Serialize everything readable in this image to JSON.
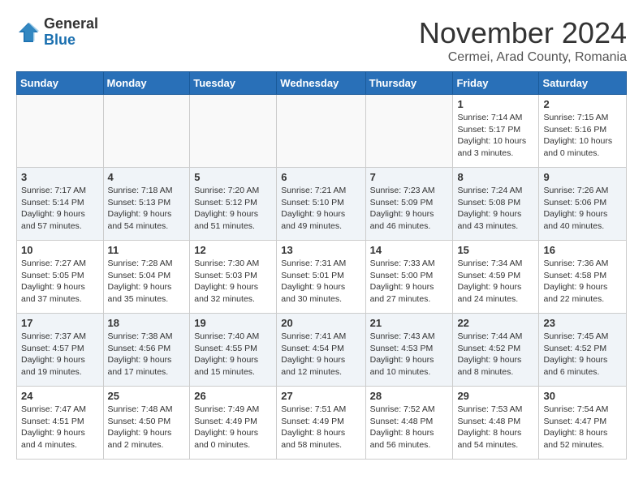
{
  "logo": {
    "general": "General",
    "blue": "Blue"
  },
  "header": {
    "month": "November 2024",
    "location": "Cermei, Arad County, Romania"
  },
  "weekdays": [
    "Sunday",
    "Monday",
    "Tuesday",
    "Wednesday",
    "Thursday",
    "Friday",
    "Saturday"
  ],
  "weeks": [
    [
      {
        "day": "",
        "info": ""
      },
      {
        "day": "",
        "info": ""
      },
      {
        "day": "",
        "info": ""
      },
      {
        "day": "",
        "info": ""
      },
      {
        "day": "",
        "info": ""
      },
      {
        "day": "1",
        "info": "Sunrise: 7:14 AM\nSunset: 5:17 PM\nDaylight: 10 hours\nand 3 minutes."
      },
      {
        "day": "2",
        "info": "Sunrise: 7:15 AM\nSunset: 5:16 PM\nDaylight: 10 hours\nand 0 minutes."
      }
    ],
    [
      {
        "day": "3",
        "info": "Sunrise: 7:17 AM\nSunset: 5:14 PM\nDaylight: 9 hours\nand 57 minutes."
      },
      {
        "day": "4",
        "info": "Sunrise: 7:18 AM\nSunset: 5:13 PM\nDaylight: 9 hours\nand 54 minutes."
      },
      {
        "day": "5",
        "info": "Sunrise: 7:20 AM\nSunset: 5:12 PM\nDaylight: 9 hours\nand 51 minutes."
      },
      {
        "day": "6",
        "info": "Sunrise: 7:21 AM\nSunset: 5:10 PM\nDaylight: 9 hours\nand 49 minutes."
      },
      {
        "day": "7",
        "info": "Sunrise: 7:23 AM\nSunset: 5:09 PM\nDaylight: 9 hours\nand 46 minutes."
      },
      {
        "day": "8",
        "info": "Sunrise: 7:24 AM\nSunset: 5:08 PM\nDaylight: 9 hours\nand 43 minutes."
      },
      {
        "day": "9",
        "info": "Sunrise: 7:26 AM\nSunset: 5:06 PM\nDaylight: 9 hours\nand 40 minutes."
      }
    ],
    [
      {
        "day": "10",
        "info": "Sunrise: 7:27 AM\nSunset: 5:05 PM\nDaylight: 9 hours\nand 37 minutes."
      },
      {
        "day": "11",
        "info": "Sunrise: 7:28 AM\nSunset: 5:04 PM\nDaylight: 9 hours\nand 35 minutes."
      },
      {
        "day": "12",
        "info": "Sunrise: 7:30 AM\nSunset: 5:03 PM\nDaylight: 9 hours\nand 32 minutes."
      },
      {
        "day": "13",
        "info": "Sunrise: 7:31 AM\nSunset: 5:01 PM\nDaylight: 9 hours\nand 30 minutes."
      },
      {
        "day": "14",
        "info": "Sunrise: 7:33 AM\nSunset: 5:00 PM\nDaylight: 9 hours\nand 27 minutes."
      },
      {
        "day": "15",
        "info": "Sunrise: 7:34 AM\nSunset: 4:59 PM\nDaylight: 9 hours\nand 24 minutes."
      },
      {
        "day": "16",
        "info": "Sunrise: 7:36 AM\nSunset: 4:58 PM\nDaylight: 9 hours\nand 22 minutes."
      }
    ],
    [
      {
        "day": "17",
        "info": "Sunrise: 7:37 AM\nSunset: 4:57 PM\nDaylight: 9 hours\nand 19 minutes."
      },
      {
        "day": "18",
        "info": "Sunrise: 7:38 AM\nSunset: 4:56 PM\nDaylight: 9 hours\nand 17 minutes."
      },
      {
        "day": "19",
        "info": "Sunrise: 7:40 AM\nSunset: 4:55 PM\nDaylight: 9 hours\nand 15 minutes."
      },
      {
        "day": "20",
        "info": "Sunrise: 7:41 AM\nSunset: 4:54 PM\nDaylight: 9 hours\nand 12 minutes."
      },
      {
        "day": "21",
        "info": "Sunrise: 7:43 AM\nSunset: 4:53 PM\nDaylight: 9 hours\nand 10 minutes."
      },
      {
        "day": "22",
        "info": "Sunrise: 7:44 AM\nSunset: 4:52 PM\nDaylight: 9 hours\nand 8 minutes."
      },
      {
        "day": "23",
        "info": "Sunrise: 7:45 AM\nSunset: 4:52 PM\nDaylight: 9 hours\nand 6 minutes."
      }
    ],
    [
      {
        "day": "24",
        "info": "Sunrise: 7:47 AM\nSunset: 4:51 PM\nDaylight: 9 hours\nand 4 minutes."
      },
      {
        "day": "25",
        "info": "Sunrise: 7:48 AM\nSunset: 4:50 PM\nDaylight: 9 hours\nand 2 minutes."
      },
      {
        "day": "26",
        "info": "Sunrise: 7:49 AM\nSunset: 4:49 PM\nDaylight: 9 hours\nand 0 minutes."
      },
      {
        "day": "27",
        "info": "Sunrise: 7:51 AM\nSunset: 4:49 PM\nDaylight: 8 hours\nand 58 minutes."
      },
      {
        "day": "28",
        "info": "Sunrise: 7:52 AM\nSunset: 4:48 PM\nDaylight: 8 hours\nand 56 minutes."
      },
      {
        "day": "29",
        "info": "Sunrise: 7:53 AM\nSunset: 4:48 PM\nDaylight: 8 hours\nand 54 minutes."
      },
      {
        "day": "30",
        "info": "Sunrise: 7:54 AM\nSunset: 4:47 PM\nDaylight: 8 hours\nand 52 minutes."
      }
    ]
  ]
}
